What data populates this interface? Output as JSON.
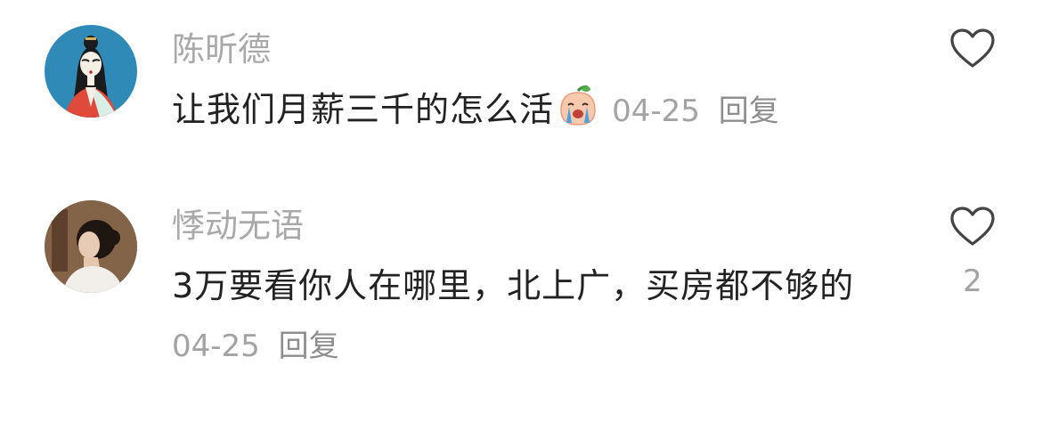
{
  "comments": [
    {
      "username": "陈昕德",
      "text": "让我们月薪三千的怎么活",
      "emoji": "crying-peach-emoji",
      "date": "04-25",
      "reply_label": "回复",
      "like_count": ""
    },
    {
      "username": "悸动无语",
      "text": "3万要看你人在哪里，北上广，买房都不够的",
      "date": "04-25",
      "reply_label": "回复",
      "like_count": "2"
    }
  ],
  "colors": {
    "username": "#a9a9a9",
    "text": "#222222",
    "meta": "#a3a3a3",
    "heart_outline": "#444444"
  }
}
